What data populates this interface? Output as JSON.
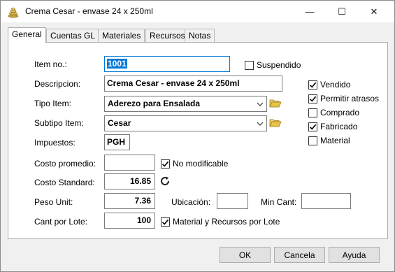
{
  "window": {
    "title": "Crema Cesar - envase 24 x 250ml",
    "minimize_glyph": "—",
    "maximize_glyph": "☐",
    "close_glyph": "✕"
  },
  "tabs": [
    {
      "label": "General",
      "active": true
    },
    {
      "label": "Cuentas GL",
      "active": false
    },
    {
      "label": "Materiales",
      "active": false
    },
    {
      "label": "Recursos",
      "active": false
    },
    {
      "label": "Notas",
      "active": false
    }
  ],
  "form": {
    "item_no": {
      "label": "Item no.:",
      "value": "1001"
    },
    "descripcion": {
      "label": "Descripcion:",
      "value": "Crema Cesar - envase 24 x 250ml"
    },
    "tipo_item": {
      "label": "Tipo Item:",
      "value": "Aderezo para Ensalada"
    },
    "subtipo_item": {
      "label": "Subtipo Item:",
      "value": "Cesar"
    },
    "impuestos": {
      "label": "Impuestos:",
      "value": "PGH"
    },
    "costo_promedio": {
      "label": "Costo promedio:",
      "value": ""
    },
    "no_modificable": {
      "label": "No modificable",
      "checked": true
    },
    "costo_standard": {
      "label": "Costo Standard:",
      "value": "16.85"
    },
    "peso_unit": {
      "label": "Peso Unit:",
      "value": "7.36"
    },
    "ubicacion": {
      "label": "Ubicación:",
      "value": ""
    },
    "min_cant": {
      "label": "Min Cant:",
      "value": ""
    },
    "cant_por_lote": {
      "label": "Cant por Lote:",
      "value": "100"
    },
    "material_recursos_lote": {
      "label": "Material y Recursos por Lote",
      "checked": true
    },
    "suspendido": {
      "label": "Suspendido",
      "checked": false
    }
  },
  "flags": [
    {
      "label": "Vendido",
      "checked": true
    },
    {
      "label": "Permitir atrasos",
      "checked": true
    },
    {
      "label": "Comprado",
      "checked": false
    },
    {
      "label": "Fabricado",
      "checked": true
    },
    {
      "label": "Material",
      "checked": false
    }
  ],
  "buttons": {
    "ok": "OK",
    "cancel": "Cancela",
    "help": "Ayuda"
  },
  "colors": {
    "accent": "#0078d7",
    "folder": "#e8c34a"
  },
  "icons": {
    "app": "stacked-coins-icon",
    "folder": "folder-open-icon",
    "refresh": "refresh-icon",
    "dropdown": "chevron-down-icon",
    "check": "checkmark-icon"
  }
}
